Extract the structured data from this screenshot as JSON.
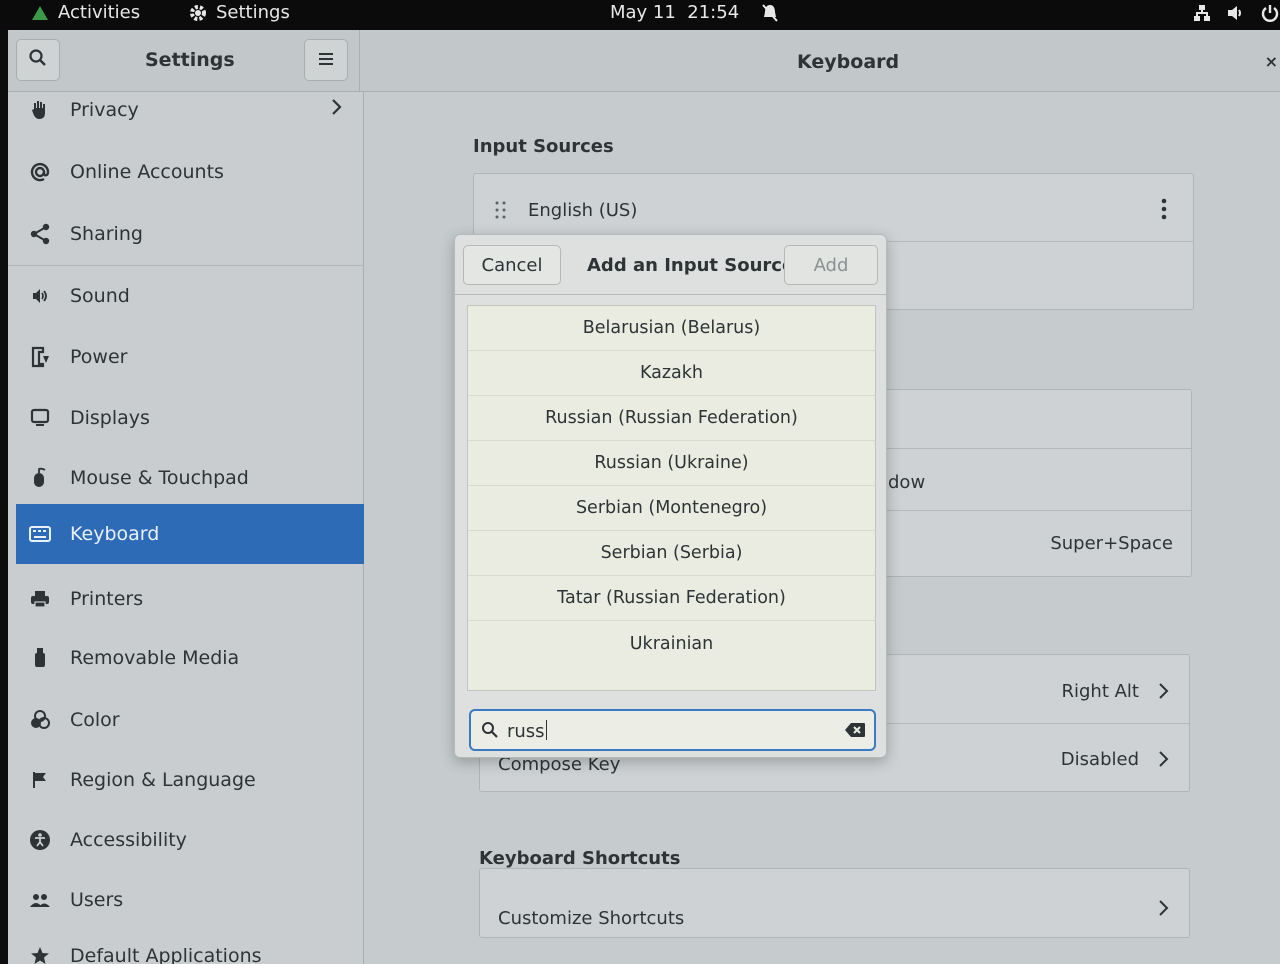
{
  "topbar": {
    "activities": "Activities",
    "app_menu": "Settings",
    "clock": "May 11  21:54"
  },
  "window": {
    "sidebar_title": "Settings",
    "panel_title": "Keyboard",
    "close": "×"
  },
  "sidebar": {
    "items": [
      {
        "label": "Privacy",
        "icon": "hand-icon"
      },
      {
        "label": "Online Accounts",
        "icon": "at-icon"
      },
      {
        "label": "Sharing",
        "icon": "share-icon"
      },
      {
        "label": "Sound",
        "icon": "speaker-icon"
      },
      {
        "label": "Power",
        "icon": "power-plug-icon"
      },
      {
        "label": "Displays",
        "icon": "display-icon"
      },
      {
        "label": "Mouse & Touchpad",
        "icon": "mouse-icon"
      },
      {
        "label": "Keyboard",
        "icon": "keyboard-icon"
      },
      {
        "label": "Printers",
        "icon": "printer-icon"
      },
      {
        "label": "Removable Media",
        "icon": "usb-icon"
      },
      {
        "label": "Color",
        "icon": "color-icon"
      },
      {
        "label": "Region & Language",
        "icon": "flag-icon"
      },
      {
        "label": "Accessibility",
        "icon": "accessibility-icon"
      },
      {
        "label": "Users",
        "icon": "users-icon"
      },
      {
        "label": "Default Applications",
        "icon": "star-icon"
      }
    ],
    "active_index": 7
  },
  "main": {
    "input_sources_title": "Input Sources",
    "input_source_1": "English (US)",
    "partial_row_text": "dow",
    "shortcut_value": "Super+Space",
    "alt_chars_value": "Right Alt",
    "compose_label": "Compose Key",
    "compose_value": "Disabled",
    "keyboard_shortcuts_title": "Keyboard Shortcuts",
    "customize_shortcuts": "Customize Shortcuts"
  },
  "dialog": {
    "cancel": "Cancel",
    "title": "Add an Input Source",
    "add": "Add",
    "results": [
      "Belarusian (Belarus)",
      "Kazakh",
      "Russian (Russian Federation)",
      "Russian (Ukraine)",
      "Serbian (Montenegro)",
      "Serbian (Serbia)",
      "Tatar (Russian Federation)",
      "Ukrainian"
    ],
    "search_value": "russ"
  },
  "colors": {
    "accent": "#2d6bb6",
    "focus_border": "#3a79c4"
  }
}
